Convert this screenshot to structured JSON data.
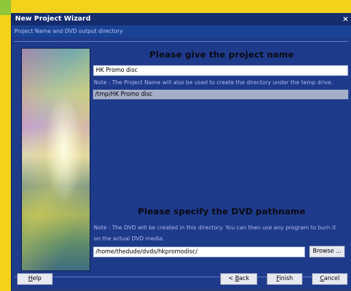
{
  "window": {
    "title": "New Project Wizard",
    "close_glyph": "×",
    "subtitle": "Project Name and DVD output directory"
  },
  "project": {
    "heading": "Please give the project name",
    "name_value": "HK Promo disc",
    "note": "Note : The Project Name will also be used to create the directory under the temp drive.",
    "temp_path": "/tmp/HK Promo disc"
  },
  "dvd": {
    "heading": "Please specify the DVD pathname",
    "note_line1": "Note : The DVD will be created in this directory. You can then use any program to burn it",
    "note_line2": "on the actual DVD media.",
    "path_value": "/home/thedude/dvds/hkpromodisc/",
    "browse_label": "Browse ..."
  },
  "buttons": {
    "help": {
      "mnemonic": "H",
      "rest": "elp"
    },
    "back": {
      "prefix": "< ",
      "mnemonic": "B",
      "rest": "ack"
    },
    "finish": {
      "mnemonic": "F",
      "rest": "inish"
    },
    "cancel": {
      "mnemonic": "C",
      "rest": "ancel"
    }
  },
  "colors": {
    "desktop": "#f2d21a",
    "window_bg": "#1e3a8a",
    "titlebar": "#142c6c",
    "field_readonly": "#a3aec8"
  },
  "icons": {
    "close": "close-icon",
    "hero": "space-shuttle-launch-image"
  }
}
